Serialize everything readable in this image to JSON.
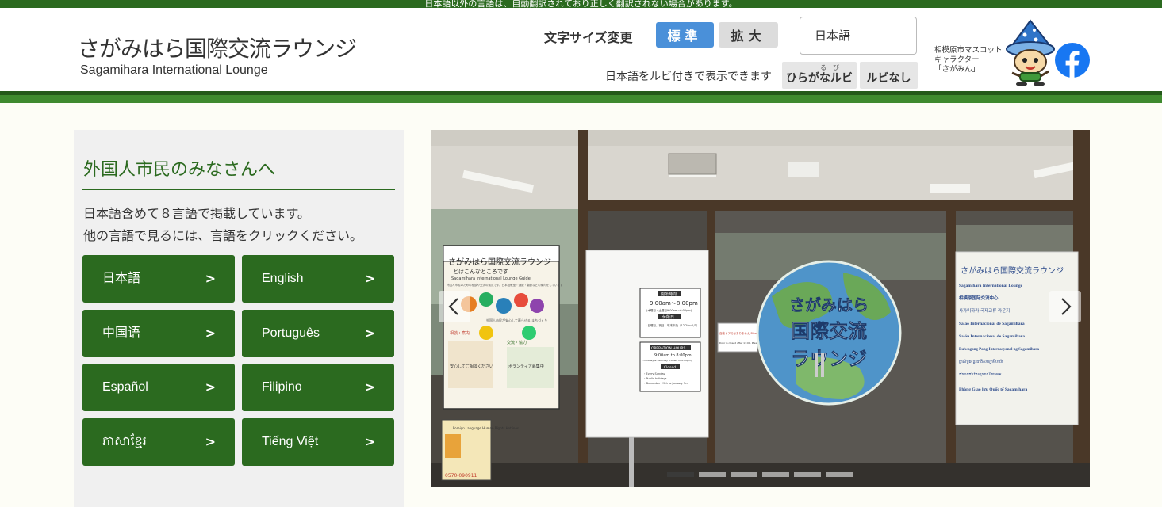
{
  "notice": "日本語以外の言語は、自動翻訳されており正しく翻訳されない場合があります。",
  "logo": {
    "title_jp": "さがみはら国際交流ラウンジ",
    "title_en": "Sagamihara International Lounge"
  },
  "font_size": {
    "label": "文字サイズ変更",
    "standard": "標準",
    "large": "拡大"
  },
  "language_select": {
    "value": "日本語"
  },
  "ruby": {
    "description": "日本語をルビ付きで表示できます",
    "on_label": "ひらがなルビ",
    "on_ruby": "る　び",
    "off_label": "ルビなし"
  },
  "mascot": {
    "caption": [
      "相模原市マスコット",
      "キャラクター",
      "「さがみん」"
    ]
  },
  "social": {
    "facebook_icon": "facebook-icon"
  },
  "panel": {
    "title": "外国人市民のみなさんへ",
    "desc_line1": "日本語含めて８言語で掲載しています。",
    "desc_line2": "他の言語で見るには、言語をクリックください。",
    "arrow": ">",
    "languages": [
      "日本語",
      "English",
      "中国语",
      "Português",
      "Español",
      "Filipino",
      "ភាសាខ្មែរ",
      "Tiếng Việt"
    ]
  },
  "slider": {
    "slide_count": 6,
    "active_slide": 1,
    "photo_text": {
      "poster_title": "さがみはら国際交流ラウンジ",
      "poster_sub": "とはこんなところです…",
      "poster_guide": "Sagamihara International Lounge Guide",
      "poster_guide_detail": "外国人市民のための相談や交流の拠点です。日本語教室・通訳・翻訳などの案内をしています",
      "poster_contact": "0570-090911",
      "poster_section1": "相談・案内",
      "poster_section2": "交流・協力",
      "poster_sub_note": "外国人市民が安心して暮らせる まちづくり",
      "poster_bottom_left": "安心してご相談ください",
      "poster_bottom_right": "ボランティア募集中",
      "small_flyer": "Foreign Language Human Rights Hotlines",
      "circle_line1": "さがみはら",
      "circle_line2": "国際交流",
      "circle_line3": "ラウンジ",
      "hours_head": "開所時間",
      "hours_value": "9:00am～8:00pm",
      "hours_note": "(木曜日・土曜日9:00am~6:00pm)",
      "closed_head": "休所日",
      "closed_value": "・日曜日、祝日、年末年始（12/29～1/3）",
      "op_head": "OPERATION HOURS",
      "op_value": "9:00am to 8:00pm",
      "op_note": "(Thursday & Saturday 9:00am to 6:00pm)",
      "closed_en_head": "Closed",
      "closed_en_1": "・Every Sunday",
      "closed_en_2": "・Public holidays",
      "closed_en_3": "・December 29th to January 3rd",
      "door_note": "自動ドアではありません Please slide the door to open",
      "door_note_en": "Door is closed after 17:00. Please enter from the side door.",
      "sign_title": "さがみはら国際交流ラウンジ",
      "sign_lines": [
        "Sagamihara International Lounge",
        "相模原国际交流中心",
        "사가미하라 국제교류 라운지",
        "Salão Internacional de Sagamihara",
        "Salón Internacional de Sagamihara",
        "Bulwagang Pang-Internasyonal ng Sagamihara",
        "ផ្លាស់ប្តូរអន្តរជាតិសាហ្គាមីហារ៉ា",
        "ສາລາສາກົນຊາກາມິຮາຣະ",
        "Phòng Giao lưu Quốc tế Sagamihara"
      ]
    }
  },
  "colors": {
    "brand_green": "#2b6a1f",
    "accent_blue": "#4a90d9",
    "facebook_blue": "#1877f2"
  }
}
